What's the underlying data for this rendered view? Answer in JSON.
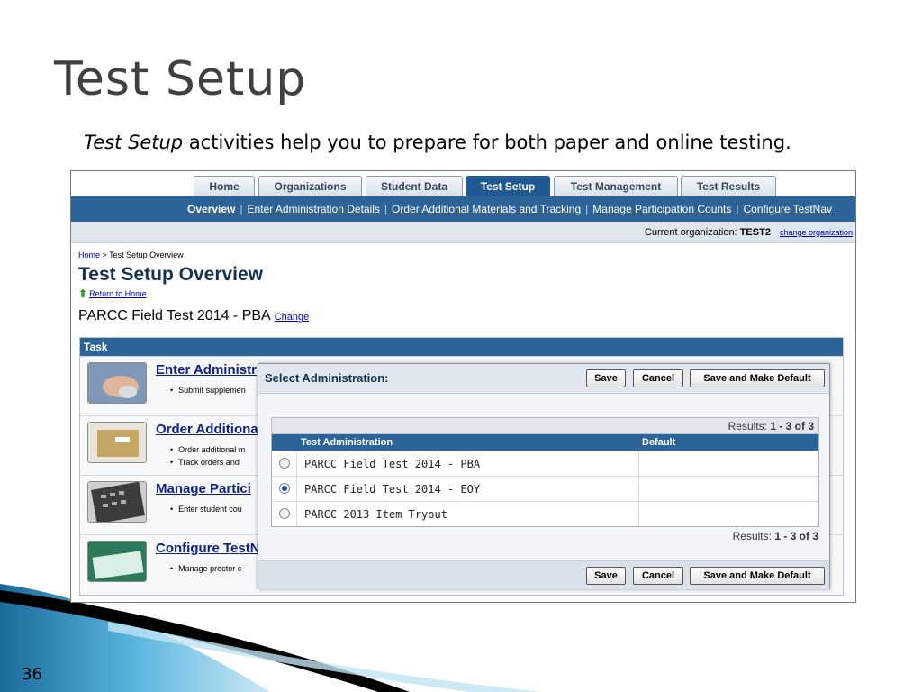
{
  "slide": {
    "title": "Test Setup",
    "subtitle_em": "Test Setup",
    "subtitle_rest": " activities help you to prepare for both paper and online testing.",
    "page_number": "36"
  },
  "tabs": [
    {
      "label": "Home",
      "active": false
    },
    {
      "label": "Organizations",
      "active": false
    },
    {
      "label": "Student Data",
      "active": false
    },
    {
      "label": "Test Setup",
      "active": true
    },
    {
      "label": "Test Management",
      "active": false
    },
    {
      "label": "Test Results",
      "active": false
    }
  ],
  "subnav": [
    {
      "label": "Overview",
      "current": true
    },
    {
      "label": "Enter Administration Details",
      "current": false
    },
    {
      "label": "Order Additional Materials and Tracking",
      "current": false
    },
    {
      "label": "Manage Participation Counts",
      "current": false
    },
    {
      "label": "Configure TestNav",
      "current": false
    }
  ],
  "org": {
    "label": "Current organization:",
    "value": "TEST2",
    "change_link": "change organization"
  },
  "breadcrumb": {
    "home": "Home",
    "rest": " > Test Setup Overview"
  },
  "page": {
    "title": "Test Setup Overview",
    "return_link": "Return to Home",
    "administration": "PARCC Field Test 2014 - PBA",
    "change_link": "Change"
  },
  "task_panel": {
    "header": "Task",
    "tasks": [
      {
        "title": "Enter Administr",
        "bullets": [
          "Submit supplemen"
        ]
      },
      {
        "title": "Order Additiona",
        "bullets": [
          "Order additional m",
          "Track orders and"
        ]
      },
      {
        "title": "Manage Partici",
        "bullets": [
          "Enter student cou"
        ]
      },
      {
        "title": "Configure TestN",
        "bullets": [
          "Manage proctor c"
        ]
      }
    ]
  },
  "modal": {
    "title": "Select Administration:",
    "save": "Save",
    "cancel": "Cancel",
    "save_default": "Save and Make Default",
    "results_label": "Results:",
    "results_range": "1 - 3 of 3",
    "columns": [
      "Test Administration",
      "Default"
    ],
    "rows": [
      {
        "name": "PARCC Field Test 2014 - PBA",
        "selected": false
      },
      {
        "name": "PARCC Field Test 2014 - EOY",
        "selected": true
      },
      {
        "name": "PARCC 2013 Item Tryout",
        "selected": false
      }
    ]
  },
  "colors": {
    "nav_blue": "#2c6399",
    "active_tab": "#1f5a93",
    "link_blue": "#0000cc",
    "heading_navy": "#15324f"
  }
}
